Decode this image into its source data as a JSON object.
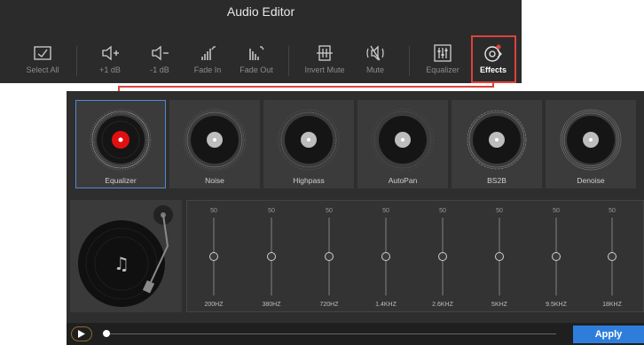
{
  "app": {
    "title": "Audio Editor"
  },
  "toolbar": {
    "items": [
      {
        "label": "Select All",
        "icon": "select-all-icon"
      },
      {
        "label": "+1 dB",
        "icon": "volume-up-icon"
      },
      {
        "label": "-1 dB",
        "icon": "volume-down-icon"
      },
      {
        "label": "Fade In",
        "icon": "fade-in-icon"
      },
      {
        "label": "Fade Out",
        "icon": "fade-out-icon"
      },
      {
        "label": "Invert Mute",
        "icon": "invert-mute-icon"
      },
      {
        "label": "Mute",
        "icon": "mute-icon"
      },
      {
        "label": "Equalizer",
        "icon": "equalizer-icon"
      },
      {
        "label": "Effects",
        "icon": "effects-icon"
      }
    ],
    "active_color": "#e0413d"
  },
  "effects": {
    "presets": [
      {
        "label": "Equalizer",
        "selected": true
      },
      {
        "label": "Noise",
        "selected": false
      },
      {
        "label": "Highpass",
        "selected": false
      },
      {
        "label": "AutoPan",
        "selected": false
      },
      {
        "label": "BS2B",
        "selected": false
      },
      {
        "label": "Denoise",
        "selected": false
      }
    ],
    "selected_color": "#4d8ad8",
    "bands": [
      {
        "value": "50",
        "freq": "200HZ"
      },
      {
        "value": "50",
        "freq": "380HZ"
      },
      {
        "value": "50",
        "freq": "720HZ"
      },
      {
        "value": "50",
        "freq": "1.4KHZ"
      },
      {
        "value": "50",
        "freq": "2.6KHZ"
      },
      {
        "value": "50",
        "freq": "5KHZ"
      },
      {
        "value": "50",
        "freq": "9.5KHZ"
      },
      {
        "value": "50",
        "freq": "18KHZ"
      }
    ]
  },
  "player": {
    "apply_label": "Apply",
    "progress": 0.0,
    "accent": "#2f7ddb"
  }
}
